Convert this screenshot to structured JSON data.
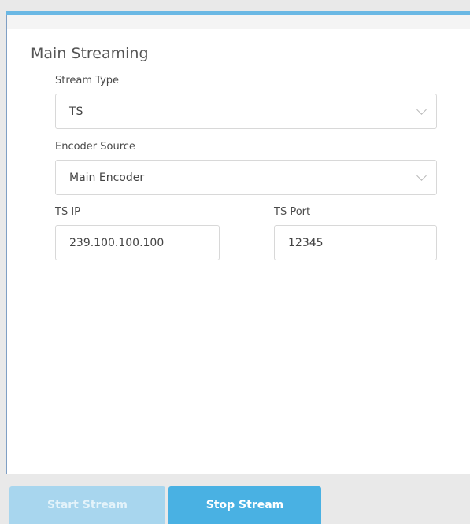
{
  "section": {
    "title": "Main Streaming"
  },
  "stream_type": {
    "label": "Stream Type",
    "value": "TS"
  },
  "encoder_source": {
    "label": "Encoder Source",
    "value": "Main Encoder"
  },
  "ts_ip": {
    "label": "TS IP",
    "value": "239.100.100.100"
  },
  "ts_port": {
    "label": "TS Port",
    "value": "12345"
  },
  "buttons": {
    "start": "Start Stream",
    "stop": "Stop Stream"
  },
  "colors": {
    "accent": "#6ab8e4",
    "button_primary": "#49b1e3",
    "button_disabled": "#a8d6ee"
  }
}
